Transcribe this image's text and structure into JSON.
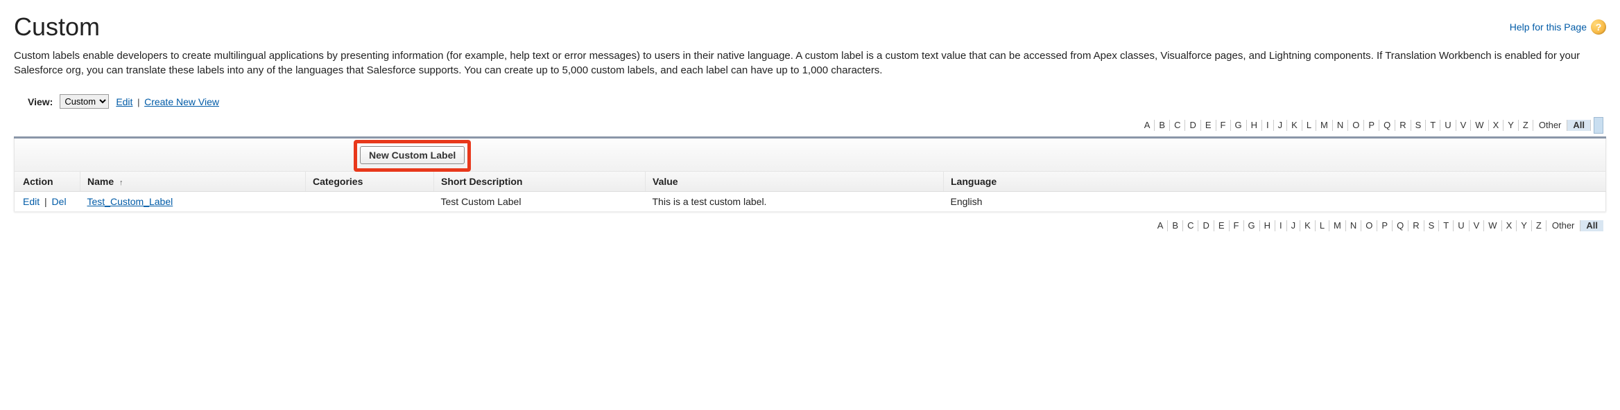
{
  "header": {
    "title": "Custom",
    "help_label": "Help for this Page"
  },
  "description": "Custom labels enable developers to create multilingual applications by presenting information (for example, help text or error messages) to users in their native language. A custom label is a custom text value that can be accessed from Apex classes, Visualforce pages, and Lightning components. If Translation Workbench is enabled for your Salesforce org, you can translate these labels into any of the languages that Salesforce supports. You can create up to 5,000 custom labels, and each label can have up to 1,000 characters.",
  "view": {
    "label": "View:",
    "selected": "Custom",
    "edit_label": "Edit",
    "create_label": "Create New View"
  },
  "alpha": {
    "letters": [
      "A",
      "B",
      "C",
      "D",
      "E",
      "F",
      "G",
      "H",
      "I",
      "J",
      "K",
      "L",
      "M",
      "N",
      "O",
      "P",
      "Q",
      "R",
      "S",
      "T",
      "U",
      "V",
      "W",
      "X",
      "Y",
      "Z"
    ],
    "other": "Other",
    "all": "All"
  },
  "buttons": {
    "new_label": "New Custom Label"
  },
  "columns": {
    "action": "Action",
    "name": "Name",
    "categories": "Categories",
    "short_desc": "Short Description",
    "value": "Value",
    "language": "Language"
  },
  "actions": {
    "edit": "Edit",
    "del": "Del"
  },
  "rows": [
    {
      "name": "Test_Custom_Label",
      "categories": "",
      "short_desc": "Test Custom Label",
      "value": "This is a test custom label.",
      "language": "English"
    }
  ]
}
